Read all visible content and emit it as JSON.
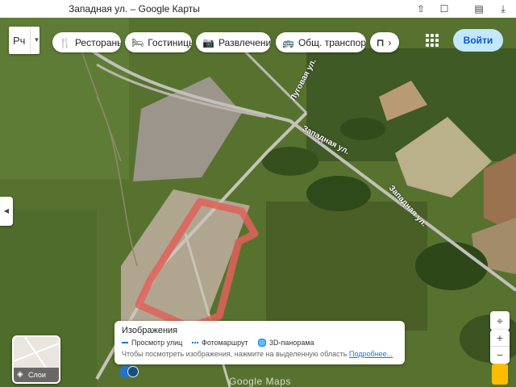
{
  "window": {
    "title": "Западная ул. – Google Карты"
  },
  "language": {
    "code": "Рч"
  },
  "categories": [
    {
      "icon": "restaurant-icon",
      "glyph": "🍴",
      "label": "Рестораны"
    },
    {
      "icon": "hotel-icon",
      "glyph": "🛏",
      "label": "Гостиницы"
    },
    {
      "icon": "camera-icon",
      "glyph": "📷",
      "label": "Развлечения"
    },
    {
      "icon": "transit-icon",
      "glyph": "🚌",
      "label": "Общ. транспорт"
    }
  ],
  "header": {
    "login_label": "Войти"
  },
  "map": {
    "street_labels": [
      "Луговая ул.",
      "Западная ул.",
      "Западная ул."
    ],
    "watermark": "Google Maps",
    "highlight_color": "#e0605a"
  },
  "layers": {
    "label": "Слои"
  },
  "imagery_panel": {
    "title": "Изображения",
    "legend": [
      {
        "label": "Просмотр улиц",
        "color": "#1a73e8",
        "style": "solid"
      },
      {
        "label": "Фотомаршрут",
        "color": "#1a73e8",
        "style": "dotted"
      },
      {
        "label": "3D-панорама",
        "color": "#4fc3f7",
        "style": "circle"
      }
    ],
    "hint_text": "Чтобы посмотреть изображения, нажмите на выделенную область",
    "more_link": "Подробнее..."
  },
  "controls": {
    "zoom_in": "+",
    "zoom_out": "−"
  }
}
